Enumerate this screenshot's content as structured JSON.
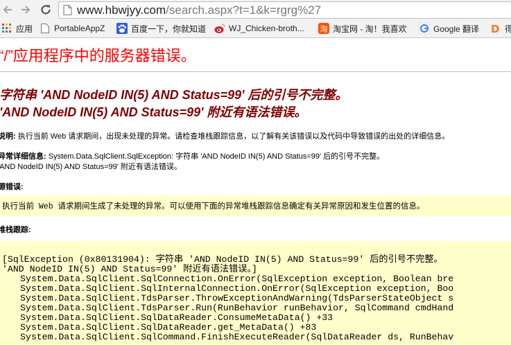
{
  "browser": {
    "url_host": "www.hbwjyy.com",
    "url_path": "/search.aspx?t=1&k=rgrg%27",
    "bookmarks": [
      {
        "label": "应用",
        "icon": "apps-grid-icon"
      },
      {
        "label": "PortableAppZ",
        "icon": "page-icon"
      },
      {
        "label": "百度一下，你就知道",
        "icon": "baidu-paw-icon"
      },
      {
        "label": "WJ_Chicken-broth...",
        "icon": "weibo-icon"
      },
      {
        "label": "淘宝网 - 淘！我喜欢",
        "icon": "taobao-icon"
      },
      {
        "label": "Google 翻译",
        "icon": "google-translate-icon"
      },
      {
        "label": "得",
        "icon": "d-logo-icon"
      }
    ]
  },
  "page": {
    "title": "“/”应用程序中的服务器错误。",
    "error_line1": "字符串 'AND NodeID IN(5) AND Status=99' 后的引号不完整。",
    "error_line2": "'AND NodeID IN(5) AND Status=99' 附近有语法错误。",
    "description_label": "说明:",
    "description_text": " 执行当前 Web 请求期间，出现未处理的异常。请检查堆栈跟踪信息，以了解有关该错误以及代码中导致错误的出处的详细信息。",
    "exception_label": "异常详细信息:",
    "exception_text": " System.Data.SqlClient.SqlException: 字符串 'AND NodeID IN(5) AND Status=99' 后的引号不完整。",
    "exception_text2": "'AND NodeID IN(5) AND Status=99' 附近有语法错误。",
    "source_label": "源错误:",
    "source_text": "执行当前 Web 请求期间生成了未处理的异常。可以使用下面的异常堆栈跟踪信息确定有关异常原因和发生位置的信息。",
    "stack_label": "堆栈跟踪:",
    "stack_lines": [
      "[SqlException (0x80131904): 字符串 'AND NodeID IN(5) AND Status=99' 后的引号不完整。",
      "'AND NodeID IN(5) AND Status=99' 附近有语法错误。]",
      "System.Data.SqlClient.SqlConnection.OnError(SqlException exception, Boolean bre",
      "System.Data.SqlClient.SqlInternalConnection.OnError(SqlException exception, Boo",
      "System.Data.SqlClient.TdsParser.ThrowExceptionAndWarning(TdsParserStateObject s",
      "System.Data.SqlClient.TdsParser.Run(RunBehavior runBehavior, SqlCommand cmdHand",
      "System.Data.SqlClient.SqlDataReader.ConsumeMetaData() +33",
      "System.Data.SqlClient.SqlDataReader.get_MetaData() +83",
      "System.Data.SqlClient.SqlCommand.FinishExecuteReader(SqlDataReader ds, RunBehav"
    ]
  }
}
